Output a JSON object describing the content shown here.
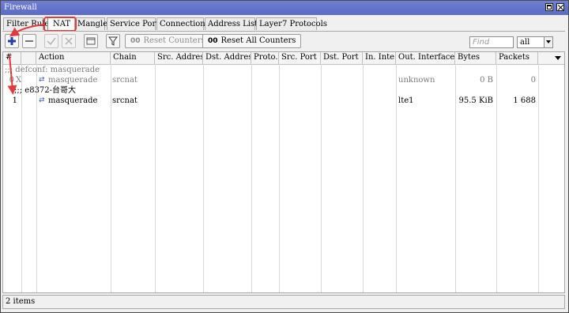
{
  "window": {
    "title": "Firewall"
  },
  "tabs": [
    "Filter Rules",
    "NAT",
    "Mangle",
    "Service Ports",
    "Connections",
    "Address Lists",
    "Layer7 Protocols"
  ],
  "active_tab": "NAT",
  "toolbar": {
    "reset_counters": "Reset Counters",
    "reset_all_counters": "Reset All Counters",
    "counter_icon": "00",
    "find_placeholder": "Find",
    "filter_value": "all"
  },
  "columns": [
    "#",
    "",
    "Action",
    "Chain",
    "Src. Address",
    "Dst. Address",
    "Proto...",
    "Src. Port",
    "Dst. Port",
    "In. Inte...",
    "Out. Interface",
    "Bytes",
    "Packets"
  ],
  "rules": [
    {
      "comment": ";;; defconf: masquerade",
      "num": "0",
      "flag": "X",
      "action": "masquerade",
      "chain": "srcnat",
      "out_interface": "unknown",
      "bytes": "0 B",
      "packets": "0",
      "disabled": true
    },
    {
      "comment": ";;; e8372-台哥大",
      "num": "1",
      "flag": "",
      "action": "masquerade",
      "chain": "srcnat",
      "out_interface": "lte1",
      "bytes": "95.5 KiB",
      "packets": "1 688",
      "disabled": false
    }
  ],
  "status": {
    "items": "2 items"
  },
  "colors": {
    "titlebar": "#5a6bc6",
    "annotation": "#e23b3b",
    "add_icon": "#1f3fae"
  }
}
